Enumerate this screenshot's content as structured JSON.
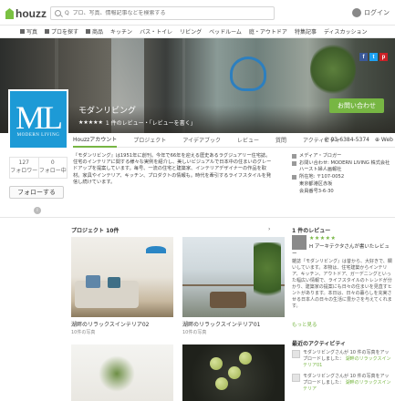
{
  "header": {
    "logo": "houzz",
    "search_placeholder": "Q  プロ、写真、情報記事などを検索する",
    "login": "ログイン"
  },
  "nav": [
    "写真",
    "プロを探す",
    "商品",
    "キッチン",
    "バス・トイレ",
    "リビング",
    "ベッドルーム",
    "庭・アウトドア",
    "特集記事",
    "ディスカッション"
  ],
  "cover": {
    "title": "モダンリビング",
    "rating_text": "1 件のレビュー・「レビューを書く」",
    "social": [
      "f",
      "t",
      "p"
    ],
    "contact_button": "お問い合わせ"
  },
  "logo_card": {
    "mark": "ML",
    "sub": "MODERN LIVING"
  },
  "tabs": [
    "Houzzアカウント",
    "プロジェクト",
    "アイデアブック",
    "レビュー",
    "質問",
    "アクティビティ"
  ],
  "phone": "03-6384-5374",
  "web": "Web",
  "stats": [
    {
      "value": "127",
      "label": "フォロワー"
    },
    {
      "value": "0",
      "label": "フォロー中"
    }
  ],
  "follow_button": "フォローする",
  "info_icon_glyph": "i",
  "description": "『モダンリビング』は1951年に創刊。今年で66年を迎える歴史あるラグジュアリー住宅誌。住宅のインテリアに関する様々な実例を紹介し、美しいビジュアルで日本中の住まいのグレードアップを提案しています。毎号、一流の住宅と建築家、インテリアデザイナーの作品を取材。家具やインテリア、キッチン、プロダクトの情報も。時代を牽引するライフスタイルを発信し続けています。",
  "meta": [
    "メディア・ブロガー",
    "お問い合わせ: MODERN LIVING 株式会社ハースト婦人画報社",
    "所在地: 〒107-0052",
    "東京都港区赤坂",
    "会員番号3-6-30"
  ],
  "projects": {
    "heading": "プロジェクト 10件",
    "more": "›",
    "cards": [
      {
        "caption": "湖畔のリラックスインテリア02",
        "count": "10件の写真"
      },
      {
        "caption": "湖畔のリラックスインテリア01",
        "count": "10件の写真"
      },
      {
        "caption": "",
        "count": ""
      },
      {
        "caption": "",
        "count": ""
      }
    ]
  },
  "reviews": {
    "heading": "1 件のレビュー",
    "stars": "★★★★★",
    "author": "H アーキテクタさんが書いたレビュー",
    "text": "雑誌『モダンリビング』は昔から、大好きで、欄いしています。本物は、住宅建築からインテリア、キッチン、アウトドア、ガーデニングといった幅広い情報で、ライフスタイルのトレンドが分かり、建築家の提案にも日々の住まいを見直すヒントがあります。本日は、日々の暮らしを充実させる日本人の日々の生活に豊かさを与えてくれます。",
    "more": "もっと見る"
  },
  "activity": {
    "heading": "最近のアクティビティ",
    "items": [
      {
        "text": "モダンリビングさんが 10 件の写真をアップロードしました：",
        "link": "湖畔のリラックスインテリア01"
      },
      {
        "text": "モダンリビングさんが 10 件の写真をアップロードしました：",
        "link": "湖畔のリラックスインテリア"
      }
    ]
  }
}
